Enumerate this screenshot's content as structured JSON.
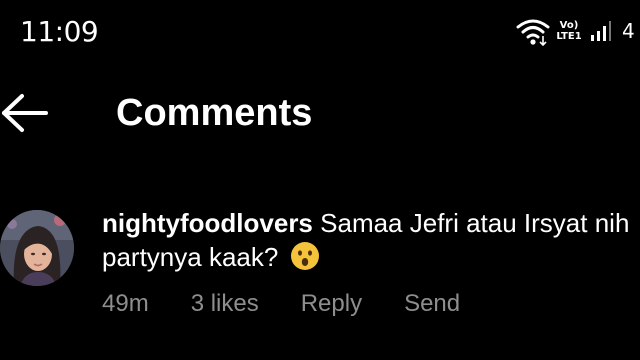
{
  "status_bar": {
    "time": "11:09",
    "network_label_top": "Vo)",
    "network_label_bottom": "LTE1",
    "battery_digit": "4",
    "icons": [
      "wifi-icon",
      "signal-icon"
    ]
  },
  "header": {
    "title": "Comments",
    "back_icon": "arrow-left-icon"
  },
  "comment": {
    "username": "nightyfoodlovers",
    "text": "Samaa Jefri atau Irsyat nih partynya kaak?",
    "emoji": "surprised-face-emoji",
    "time": "49m",
    "likes": "3 likes",
    "reply_label": "Reply",
    "send_label": "Send"
  },
  "colors": {
    "background": "#000000",
    "text": "#ffffff",
    "meta_text": "#8e8e8e",
    "emoji": "#f5c33b"
  }
}
